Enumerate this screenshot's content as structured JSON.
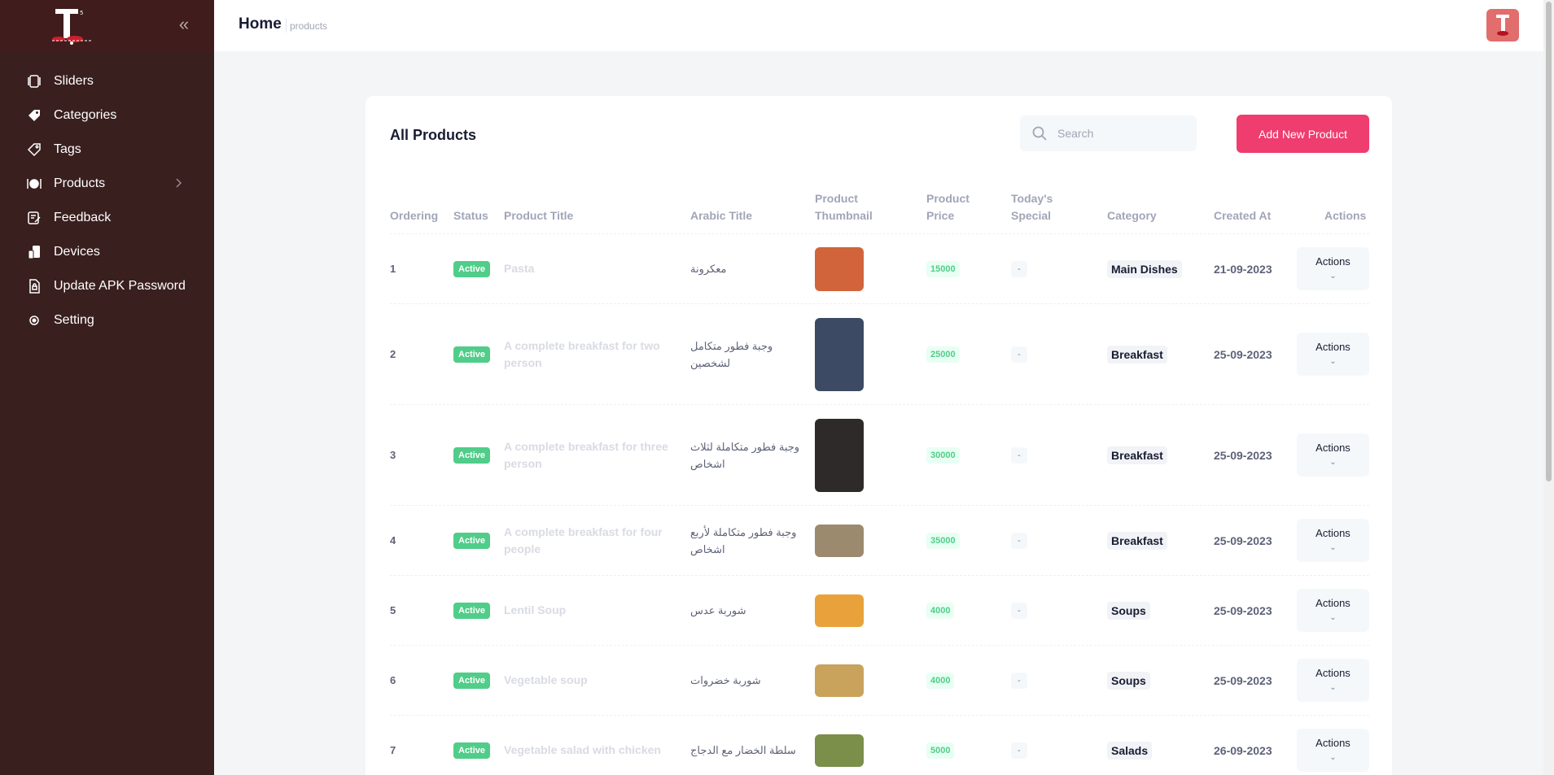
{
  "sidebar": {
    "logo_label": "T",
    "items": [
      {
        "label": "Sliders",
        "icon": "sliders-icon"
      },
      {
        "label": "Categories",
        "icon": "tag-filled-icon"
      },
      {
        "label": "Tags",
        "icon": "tag-outline-icon"
      },
      {
        "label": "Products",
        "icon": "dish-icon",
        "has_submenu": true
      },
      {
        "label": "Feedback",
        "icon": "feedback-icon"
      },
      {
        "label": "Devices",
        "icon": "devices-icon"
      },
      {
        "label": "Update APK Password",
        "icon": "lock-file-icon"
      },
      {
        "label": "Setting",
        "icon": "gear-icon"
      }
    ]
  },
  "header": {
    "title": "Home",
    "breadcrumb": "products"
  },
  "card": {
    "title": "All Products",
    "search_placeholder": "Search",
    "add_button": "Add New Product"
  },
  "table": {
    "headers": {
      "ordering": "Ordering",
      "status": "Status",
      "title": "Product Title",
      "arabic": "Arabic Title",
      "thumbnail": "Product Thumbnail",
      "price": "Product Price",
      "special": "Today's Special",
      "category": "Category",
      "created": "Created At",
      "actions": "Actions"
    },
    "rows": [
      {
        "ordering": "1",
        "status": "Active",
        "title": "Pasta",
        "arabic": "معكرونة",
        "price": "15000",
        "special": "-",
        "category": "Main Dishes",
        "created": "21-09-2023",
        "action": "Actions",
        "thumb_color": "#d2643c"
      },
      {
        "ordering": "2",
        "status": "Active",
        "title": "A complete breakfast for two person",
        "arabic": "وجبة فطور متكامل لشخصين",
        "price": "25000",
        "special": "-",
        "category": "Breakfast",
        "created": "25-09-2023",
        "action": "Actions",
        "thumb_color": "#3c4a63"
      },
      {
        "ordering": "3",
        "status": "Active",
        "title": "A complete breakfast for three person",
        "arabic": "وجبة فطور متكاملة لثلاث اشخاص",
        "price": "30000",
        "special": "-",
        "category": "Breakfast",
        "created": "25-09-2023",
        "action": "Actions",
        "thumb_color": "#2e2a2a"
      },
      {
        "ordering": "4",
        "status": "Active",
        "title": "A complete breakfast for four people",
        "arabic": "وجبة فطور متكاملة لأربع اشخاص",
        "price": "35000",
        "special": "-",
        "category": "Breakfast",
        "created": "25-09-2023",
        "action": "Actions",
        "thumb_color": "#9b8a6e"
      },
      {
        "ordering": "5",
        "status": "Active",
        "title": "Lentil Soup",
        "arabic": "شوربة عدس",
        "price": "4000",
        "special": "-",
        "category": "Soups",
        "created": "25-09-2023",
        "action": "Actions",
        "thumb_color": "#e9a23b"
      },
      {
        "ordering": "6",
        "status": "Active",
        "title": "Vegetable soup",
        "arabic": "شوربة خضروات",
        "price": "4000",
        "special": "-",
        "category": "Soups",
        "created": "25-09-2023",
        "action": "Actions",
        "thumb_color": "#c9a25c"
      },
      {
        "ordering": "7",
        "status": "Active",
        "title": "Vegetable salad with chicken",
        "arabic": "سلطة الخضار مع الدجاج",
        "price": "5000",
        "special": "-",
        "category": "Salads",
        "created": "26-09-2023",
        "action": "Actions",
        "thumb_color": "#7b8e4a"
      }
    ]
  },
  "colors": {
    "sidebar_bg": "#3a1f1f",
    "accent": "#ee3d6e",
    "success": "#50cd89"
  }
}
